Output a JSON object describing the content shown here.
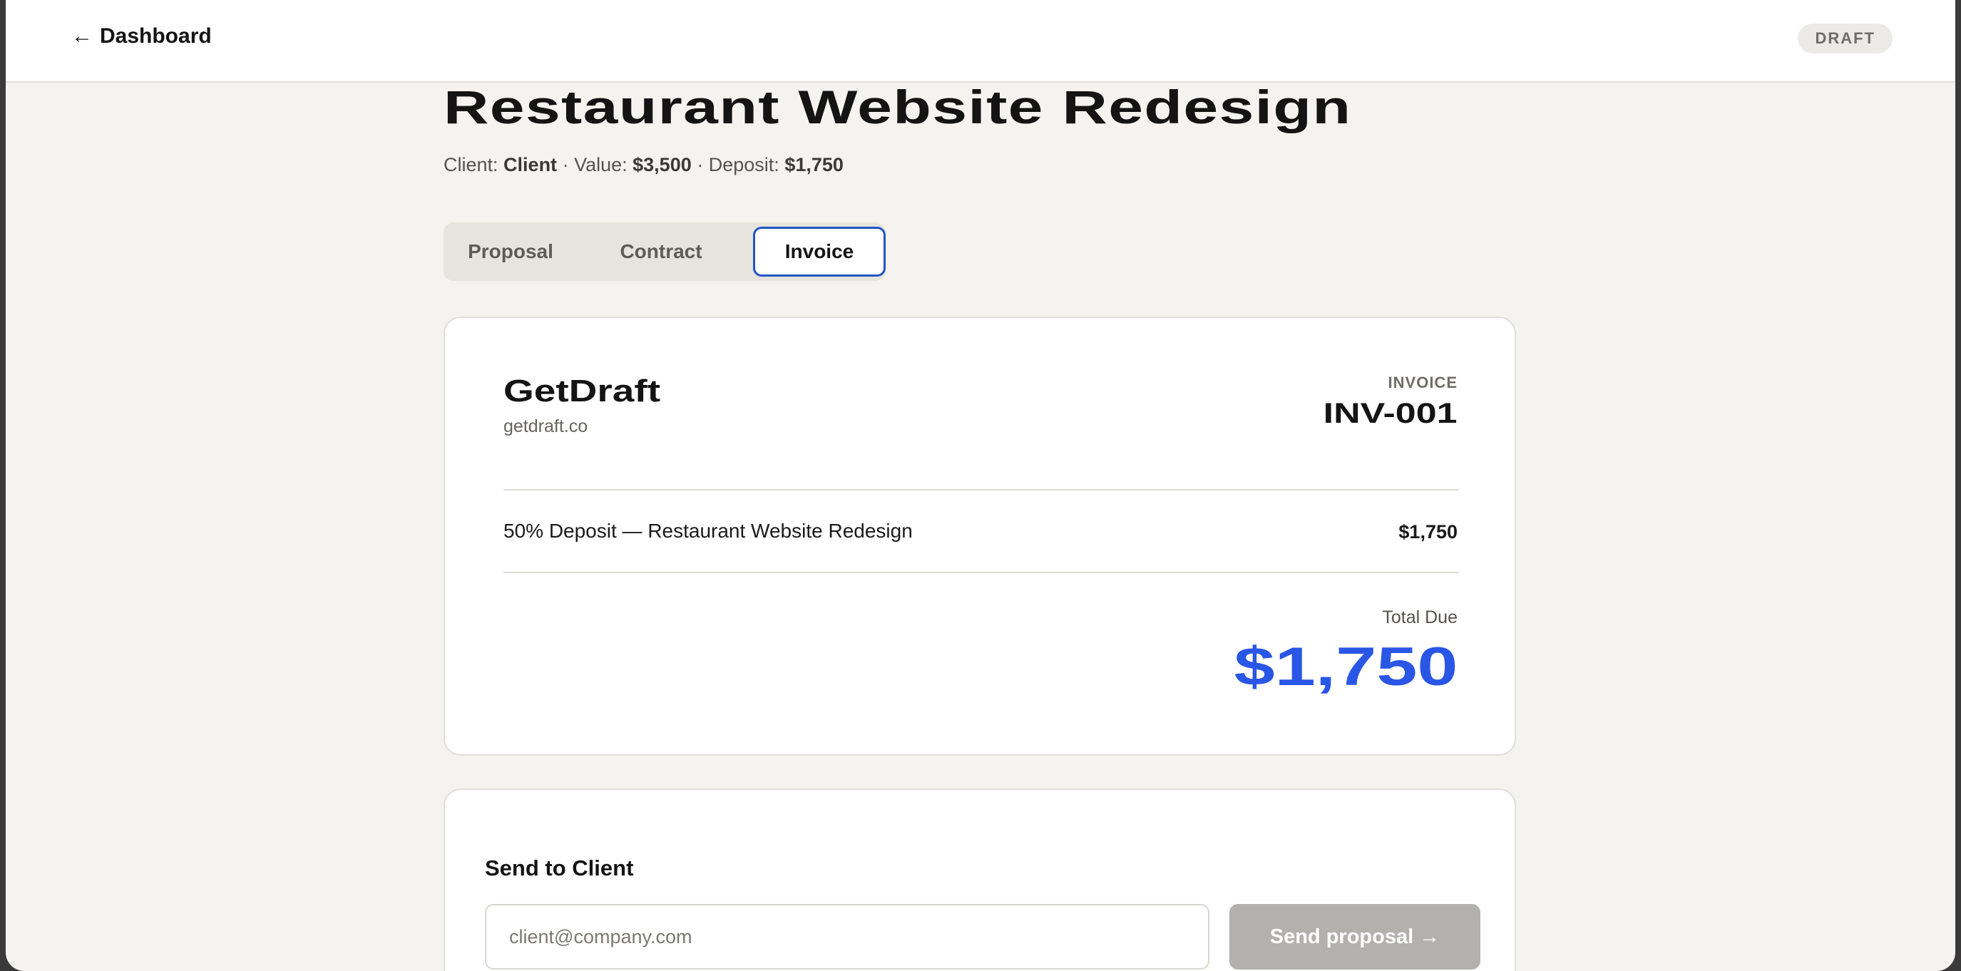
{
  "topbar": {
    "back_arrow": "←",
    "back_label": "Dashboard",
    "status": "DRAFT"
  },
  "project": {
    "title": "Restaurant Website Redesign",
    "client_label": "Client:",
    "client": "Client",
    "value_label": "· Value:",
    "value": "$3,500",
    "deposit_label": "· Deposit:",
    "deposit": "$1,750"
  },
  "tabs": [
    {
      "label": "Proposal",
      "active": false
    },
    {
      "label": "Contract",
      "active": false
    },
    {
      "label": "Invoice",
      "active": true
    }
  ],
  "invoice": {
    "brand_name": "GetDraft",
    "brand_url": "getdraft.co",
    "label": "INVOICE",
    "number": "INV-001",
    "line_items": [
      {
        "description": "50% Deposit — Restaurant Website Redesign",
        "amount": "$1,750"
      }
    ],
    "total_label": "Total Due",
    "total": "$1,750"
  },
  "send": {
    "title": "Send to Client",
    "email_placeholder": "client@company.com",
    "email_value": "",
    "button_label": "Send proposal →"
  },
  "colors": {
    "accent": "#2a56e6",
    "tab_focus": "#2255c4",
    "background": "#f4f3ef",
    "button_disabled": "#b2b1ae"
  }
}
